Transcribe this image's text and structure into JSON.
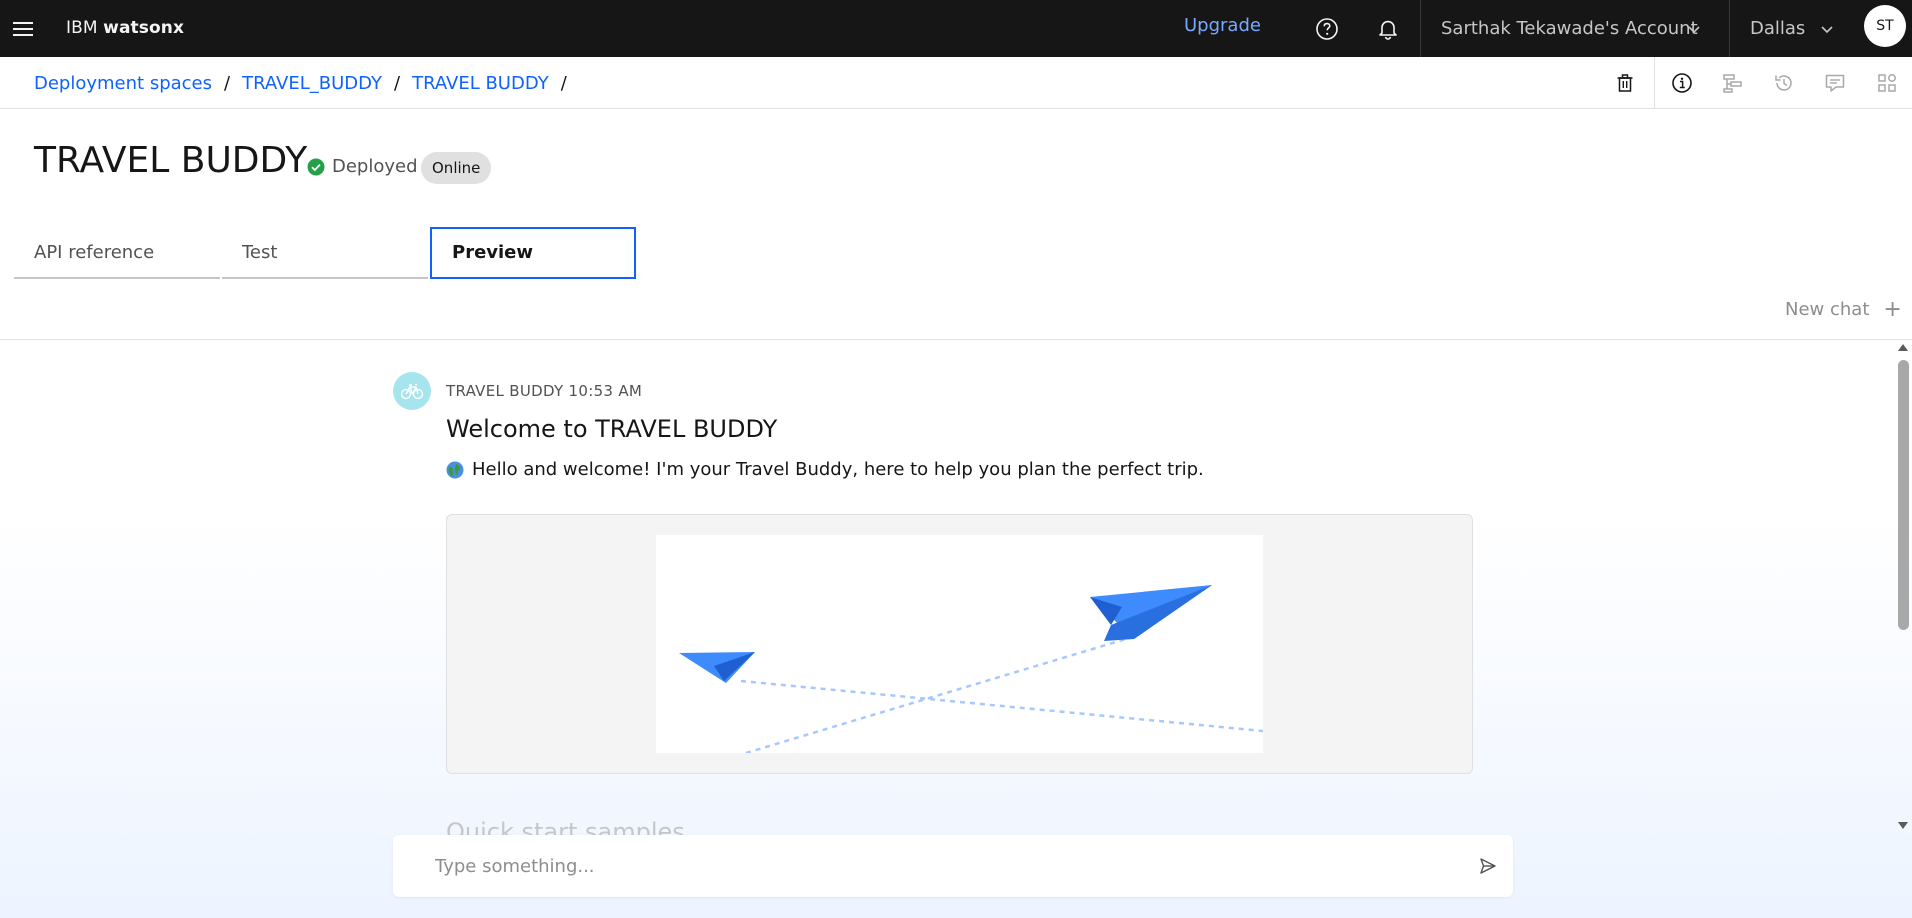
{
  "header": {
    "brand_prefix": "IBM",
    "brand_product": "watsonx",
    "upgrade_label": "Upgrade",
    "account_label": "Sarthak Tekawade's Account",
    "region_label": "Dallas",
    "avatar_initials": "ST",
    "icons": [
      "menu-icon",
      "help-icon",
      "notification-icon",
      "chevron-down-icon"
    ]
  },
  "breadcrumb": {
    "items": [
      "Deployment spaces",
      "TRAVEL_BUDDY",
      "TRAVEL BUDDY"
    ],
    "separator": "/"
  },
  "toolbar": {
    "icons": [
      "trash-icon",
      "info-icon",
      "tree-structure-icon",
      "history-icon",
      "comment-icon",
      "apps-icon"
    ]
  },
  "deployment": {
    "title": "TRAVEL BUDDY",
    "status_label": "Deployed",
    "tag_label": "Online"
  },
  "tabs": [
    {
      "label": "API reference",
      "selected": false
    },
    {
      "label": "Test",
      "selected": false
    },
    {
      "label": "Preview",
      "selected": true
    }
  ],
  "chat": {
    "new_chat_label": "New chat",
    "new_chat_icon": "+",
    "message": {
      "sender": "TRAVEL BUDDY",
      "time": "10:53 AM",
      "title": "Welcome to TRAVEL BUDDY",
      "text": "Hello and welcome! I'm your Travel Buddy, here to help you plan the perfect trip."
    },
    "quick_start_label": "Quick start samples",
    "input_placeholder": "Type something..."
  },
  "colors": {
    "accent": "#0f62fe",
    "topbar_bg": "#161616",
    "upgrade_link": "#78a9ff",
    "success": "#24a148",
    "bot_avatar_bg": "#a6e4ee",
    "plane_blue": "#3d8bfd"
  }
}
